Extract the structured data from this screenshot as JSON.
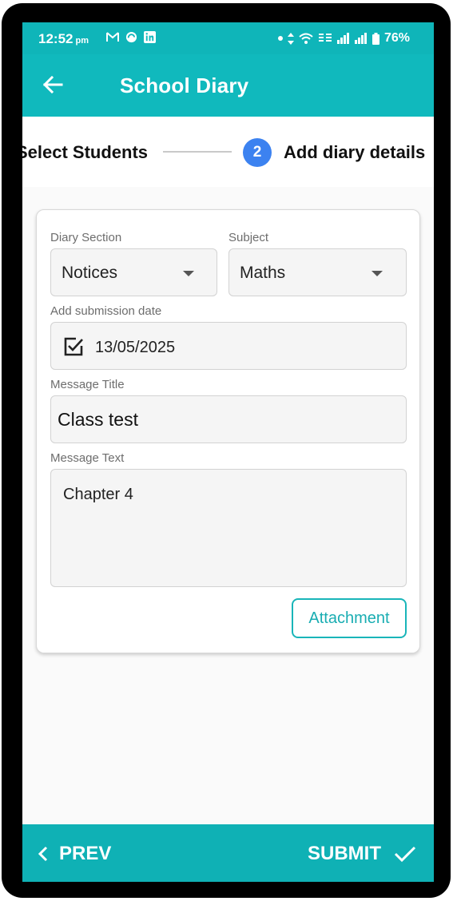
{
  "status_bar": {
    "time": "12:52",
    "time_suffix": "pm",
    "battery": "76%",
    "icons": [
      "gmail-icon",
      "sync-icon",
      "linkedin-icon",
      "dot-icon",
      "data-arrows-icon",
      "wifi-icon",
      "volte-icon",
      "signal-icon",
      "signal-icon",
      "battery-icon"
    ]
  },
  "app_bar": {
    "title": "School Diary",
    "back_icon": "arrow-left-icon"
  },
  "stepper": {
    "step1_label": "Select Students",
    "step2_number": "2",
    "step2_label": "Add diary details",
    "active_color": "#3c82f0"
  },
  "form": {
    "diary_section": {
      "label": "Diary Section",
      "value": "Notices"
    },
    "subject": {
      "label": "Subject",
      "value": "Maths"
    },
    "submission_date": {
      "label": "Add submission date",
      "value": "13/05/2025",
      "checked": true
    },
    "message_title": {
      "label": "Message Title",
      "value": "Class test"
    },
    "message_text": {
      "label": "Message Text",
      "value": "Chapter 4"
    },
    "attachment_label": "Attachment"
  },
  "bottom_bar": {
    "prev_label": "PREV",
    "submit_label": "SUBMIT"
  },
  "colors": {
    "primary": "#10b9bd",
    "accent": "#3c82f0"
  }
}
